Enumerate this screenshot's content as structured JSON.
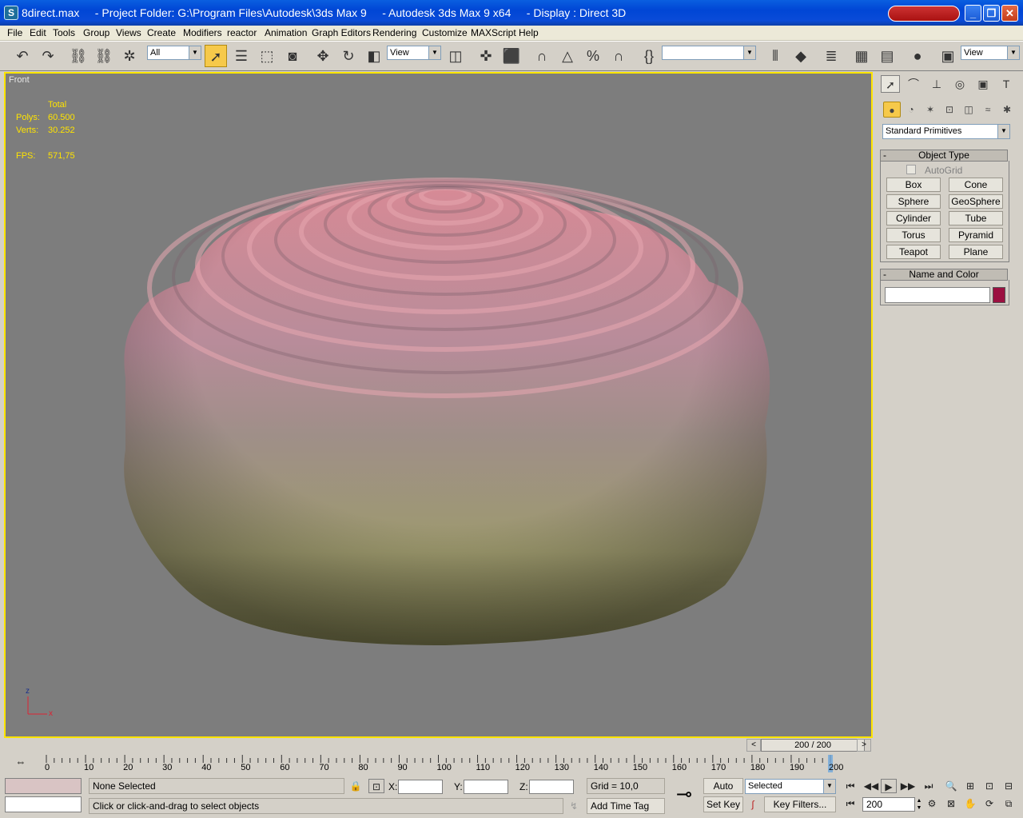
{
  "window": {
    "title": "8direct.max     - Project Folder: G:\\Program Files\\Autodesk\\3ds Max 9     - Autodesk 3ds Max 9 x64     - Display : Direct 3D"
  },
  "menu": [
    "File",
    "Edit",
    "Tools",
    "Group",
    "Views",
    "Create",
    "Modifiers",
    "reactor",
    "Animation",
    "Graph Editors",
    "Rendering",
    "Customize",
    "MAXScript",
    "Help"
  ],
  "toolbar": {
    "selection_filter": "All",
    "reference_coord": "View",
    "named_selection": "",
    "view_combo": "View"
  },
  "viewport": {
    "label": "Front",
    "stats_header": "Total",
    "polys_label": "Polys:",
    "polys_value": "60.500",
    "verts_label": "Verts:",
    "verts_value": "30.252",
    "fps_label": "FPS:",
    "fps_value": "571,75",
    "axis_z": "z",
    "axis_x": "x"
  },
  "command_panel": {
    "category": "Standard Primitives",
    "object_type_title": "Object Type",
    "autogrid_label": "AutoGrid",
    "autogrid_checked": false,
    "buttons": [
      "Box",
      "Cone",
      "Sphere",
      "GeoSphere",
      "Cylinder",
      "Tube",
      "Torus",
      "Pyramid",
      "Teapot",
      "Plane"
    ],
    "name_color_title": "Name and Color",
    "name_value": "",
    "color": "#9b1040"
  },
  "timeline": {
    "frame_display": "200 / 200",
    "ticks": [
      "0",
      "10",
      "20",
      "30",
      "40",
      "50",
      "60",
      "70",
      "80",
      "90",
      "100",
      "110",
      "120",
      "130",
      "140",
      "150",
      "160",
      "170",
      "180",
      "190",
      "200"
    ]
  },
  "status": {
    "selection_text": "None Selected",
    "prompt_text": "Click or click-and-drag to select objects",
    "x_label": "X:",
    "y_label": "Y:",
    "z_label": "Z:",
    "x_value": "",
    "y_value": "",
    "z_value": "",
    "grid_text": "Grid = 10,0",
    "add_time_tag": "Add Time Tag",
    "auto_key": "Auto Key",
    "set_key": "Set Key",
    "key_mode": "Selected",
    "key_filters": "Key Filters...",
    "current_frame": "200"
  }
}
